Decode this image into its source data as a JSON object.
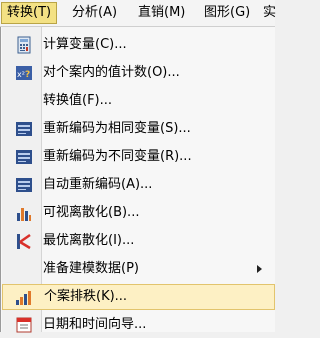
{
  "menubar": {
    "menus": [
      {
        "label": "转换(T)"
      },
      {
        "label": "分析(A)"
      },
      {
        "label": "直销(M)"
      },
      {
        "label": "图形(G)"
      },
      {
        "label": "实"
      }
    ]
  },
  "dropdown": {
    "items": [
      {
        "label": "计算变量(C)...",
        "icon": "calculator-icon"
      },
      {
        "label": "对个案内的值计数(O)...",
        "icon": "count-values-icon"
      },
      {
        "label": "转换值(F)...",
        "icon": ""
      },
      {
        "label": "重新编码为相同变量(S)...",
        "icon": "recode-same-icon"
      },
      {
        "label": "重新编码为不同变量(R)...",
        "icon": "recode-different-icon"
      },
      {
        "label": "自动重新编码(A)...",
        "icon": "auto-recode-icon"
      },
      {
        "label": "可视离散化(B)...",
        "icon": "visual-binning-icon"
      },
      {
        "label": "最优离散化(I)...",
        "icon": "optimal-binning-icon"
      },
      {
        "label": "准备建模数据(P)",
        "icon": ""
      },
      {
        "label": "个案排秩(K)...",
        "icon": "rank-cases-icon"
      },
      {
        "label": "日期和时间向导...",
        "icon": "date-time-icon"
      }
    ]
  },
  "colors": {
    "highlight": "#fdf0c4",
    "highlight_border": "#e2c46d",
    "active_menu": "#f3e184"
  }
}
